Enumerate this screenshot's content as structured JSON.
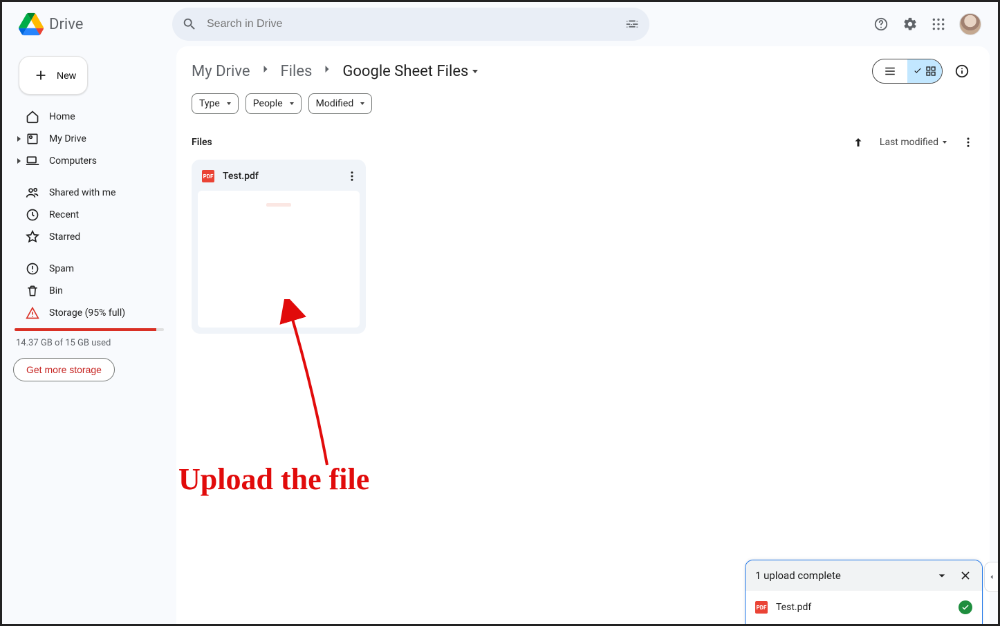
{
  "app": {
    "name": "Drive",
    "search_placeholder": "Search in Drive"
  },
  "sidebar": {
    "new_label": "New",
    "items": [
      {
        "label": "Home"
      },
      {
        "label": "My Drive"
      },
      {
        "label": "Computers"
      },
      {
        "label": "Shared with me"
      },
      {
        "label": "Recent"
      },
      {
        "label": "Starred"
      },
      {
        "label": "Spam"
      },
      {
        "label": "Bin"
      },
      {
        "label": "Storage (95% full)"
      }
    ],
    "storage_used": "14.37 GB of 15 GB used",
    "storage_percent": 95,
    "get_storage": "Get more storage"
  },
  "breadcrumbs": {
    "segments": [
      "My Drive",
      "Files",
      "Google Sheet Files"
    ]
  },
  "filters": {
    "chips": [
      "Type",
      "People",
      "Modified"
    ]
  },
  "section": {
    "title": "Files",
    "sort_label": "Last modified"
  },
  "files": [
    {
      "name": "Test.pdf",
      "kind": "pdf"
    }
  ],
  "toast": {
    "title": "1 upload complete",
    "items": [
      {
        "name": "Test.pdf",
        "kind": "pdf",
        "status": "done"
      }
    ]
  },
  "annotation": {
    "text": "Upload the file"
  }
}
